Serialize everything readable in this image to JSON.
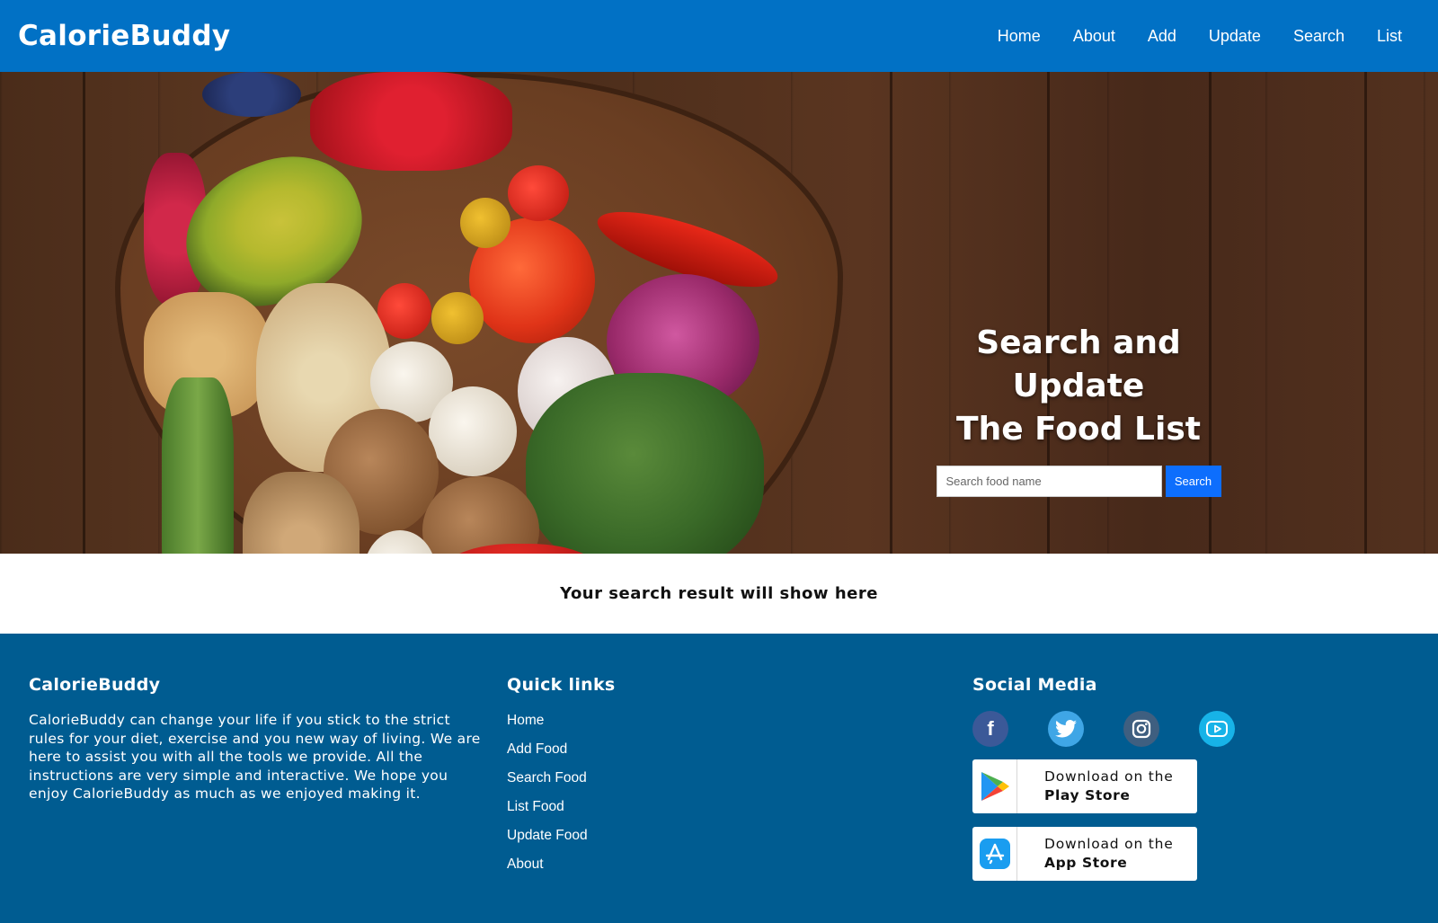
{
  "header": {
    "brand": "CalorieBuddy",
    "nav": [
      "Home",
      "About",
      "Add",
      "Update",
      "Search",
      "List"
    ]
  },
  "hero": {
    "title_line1": "Search and Update",
    "title_line2": "The Food List",
    "search_placeholder": "Search food name",
    "search_button": "Search"
  },
  "result": {
    "text": "Your search result will show here"
  },
  "footer": {
    "about": {
      "title": "CalorieBuddy",
      "text": "CalorieBuddy can change your life if you stick to the strict rules for your diet, exercise and you new way of living. We are here to assist you with all the tools we provide. All the instructions are very simple and interactive. We hope you enjoy CalorieBuddy as much as we enjoyed making it."
    },
    "links": {
      "title": "Quick links",
      "items": [
        "Home",
        "Add Food",
        "Search Food",
        "List Food",
        "Update Food",
        "About"
      ]
    },
    "social": {
      "title": "Social Media",
      "icons": [
        "facebook-icon",
        "twitter-icon",
        "instagram-icon",
        "youtube-icon"
      ],
      "stores": [
        {
          "top": "Download on the",
          "name": "Play Store",
          "icon": "play-store-icon"
        },
        {
          "top": "Download on the",
          "name": "App Store",
          "icon": "app-store-icon"
        }
      ]
    }
  },
  "colors": {
    "header_bg": "#0171c5",
    "footer_bg": "#005c91",
    "search_button": "#0d6efd"
  }
}
